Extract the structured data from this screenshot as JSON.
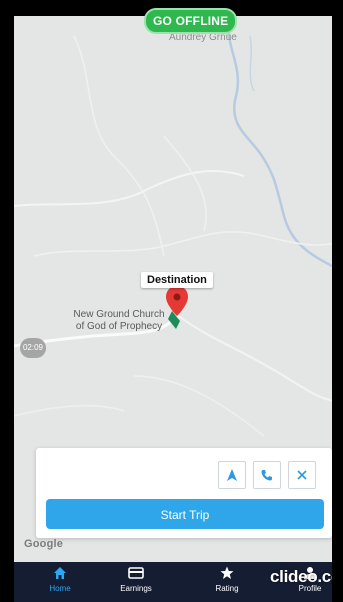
{
  "status": {
    "go_offline_label": "GO OFFLINE"
  },
  "map": {
    "top_label": "Aundrey Grnue",
    "destination_label": "Destination",
    "place_line1": "New Ground Church",
    "place_line2": "of God of Prophecy",
    "time_chip": "02:09",
    "attribution": "Google"
  },
  "trip_card": {
    "start_trip_label": "Start Trip",
    "actions": [
      "navigate-icon",
      "phone-icon",
      "close-icon"
    ]
  },
  "nav": {
    "items": [
      {
        "label": "Home",
        "icon": "home-icon",
        "active": true
      },
      {
        "label": "Earnings",
        "icon": "wallet-icon",
        "active": false
      },
      {
        "label": "Rating",
        "icon": "star-icon",
        "active": false
      },
      {
        "label": "Profile",
        "icon": "person-icon",
        "active": false
      }
    ]
  },
  "watermark": "clideo.com",
  "colors": {
    "offline_green": "#2eb84d",
    "start_trip_blue": "#2fa6ea",
    "nav_bg": "#151d33",
    "active_tab": "#2aa8f0",
    "pin_red": "#e53935"
  }
}
